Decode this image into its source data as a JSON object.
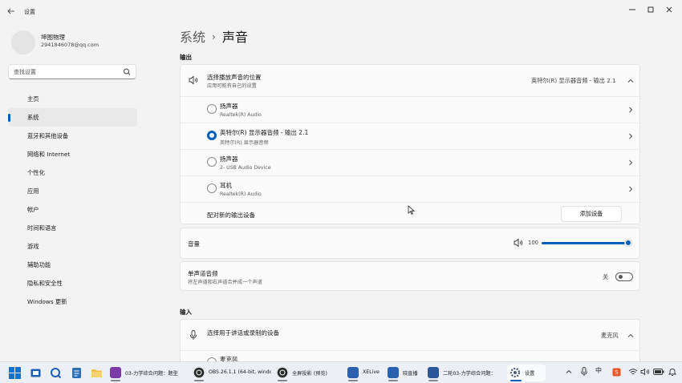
{
  "window": {
    "title": "设置",
    "back_icon": "back-arrow-icon"
  },
  "account": {
    "name": "坤图物理",
    "email": "2941846078@qq.com"
  },
  "search": {
    "placeholder": "查找设置",
    "icon": "search-icon"
  },
  "sidebar": {
    "items": [
      {
        "label": "主页",
        "active": false
      },
      {
        "label": "系统",
        "active": true
      },
      {
        "label": "蓝牙和其他设备",
        "active": false
      },
      {
        "label": "网络和 Internet",
        "active": false
      },
      {
        "label": "个性化",
        "active": false
      },
      {
        "label": "应用",
        "active": false
      },
      {
        "label": "帐户",
        "active": false
      },
      {
        "label": "时间和语言",
        "active": false
      },
      {
        "label": "游戏",
        "active": false
      },
      {
        "label": "辅助功能",
        "active": false
      },
      {
        "label": "隐私和安全性",
        "active": false
      },
      {
        "label": "Windows 更新",
        "active": false
      }
    ]
  },
  "breadcrumb": {
    "parent": "系统",
    "separator": "›",
    "current": "声音"
  },
  "output": {
    "section_label": "输出",
    "choose_title": "选择播放声音的位置",
    "choose_sub": "应用可能有自己的设置",
    "selected_device": "英特尔(R) 显示器音频 - 输出 2.1",
    "devices": [
      {
        "name": "扬声器",
        "sub": "Realtek(R) Audio",
        "selected": false
      },
      {
        "name": "英特尔(R) 显示器音频 - 输出 2.1",
        "sub": "英特尔(R) 显示器音频",
        "selected": true
      },
      {
        "name": "扬声器",
        "sub": "2- USB Audio Device",
        "selected": false
      },
      {
        "name": "耳机",
        "sub": "Realtek(R) Audio",
        "selected": false
      }
    ],
    "pair_label": "配对新的输出设备",
    "add_button": "添加设备"
  },
  "volume": {
    "label": "音量",
    "value": "100",
    "level": 1.0
  },
  "mono": {
    "title": "单声道音频",
    "sub": "将左声道和右声道合并成一个声道",
    "state": "关"
  },
  "input": {
    "section_label": "输入",
    "choose_title": "选择用于讲话或录制的设备",
    "selected_device": "麦克风",
    "first_device": "麦克风"
  },
  "taskbar": {
    "apps": [
      {
        "label": "03-力学综合问题：题型",
        "color": "#7a3aa8"
      },
      {
        "label": "OBS 26.1.1 (64-bit, windo",
        "color": "#2b2b2b"
      },
      {
        "label": "全屏投影 (预览)",
        "color": "#2b2b2b"
      },
      {
        "label": "XELive",
        "color": "#2b5fb0"
      },
      {
        "label": "晓直播",
        "color": "#2b5fb0"
      },
      {
        "label": "二轮03-力学综合问题：",
        "color": "#2b579a"
      },
      {
        "label": "设置",
        "color": "#4a5a70"
      }
    ],
    "tray": {
      "ime": "中"
    }
  },
  "colors": {
    "accent": "#005fb8"
  }
}
